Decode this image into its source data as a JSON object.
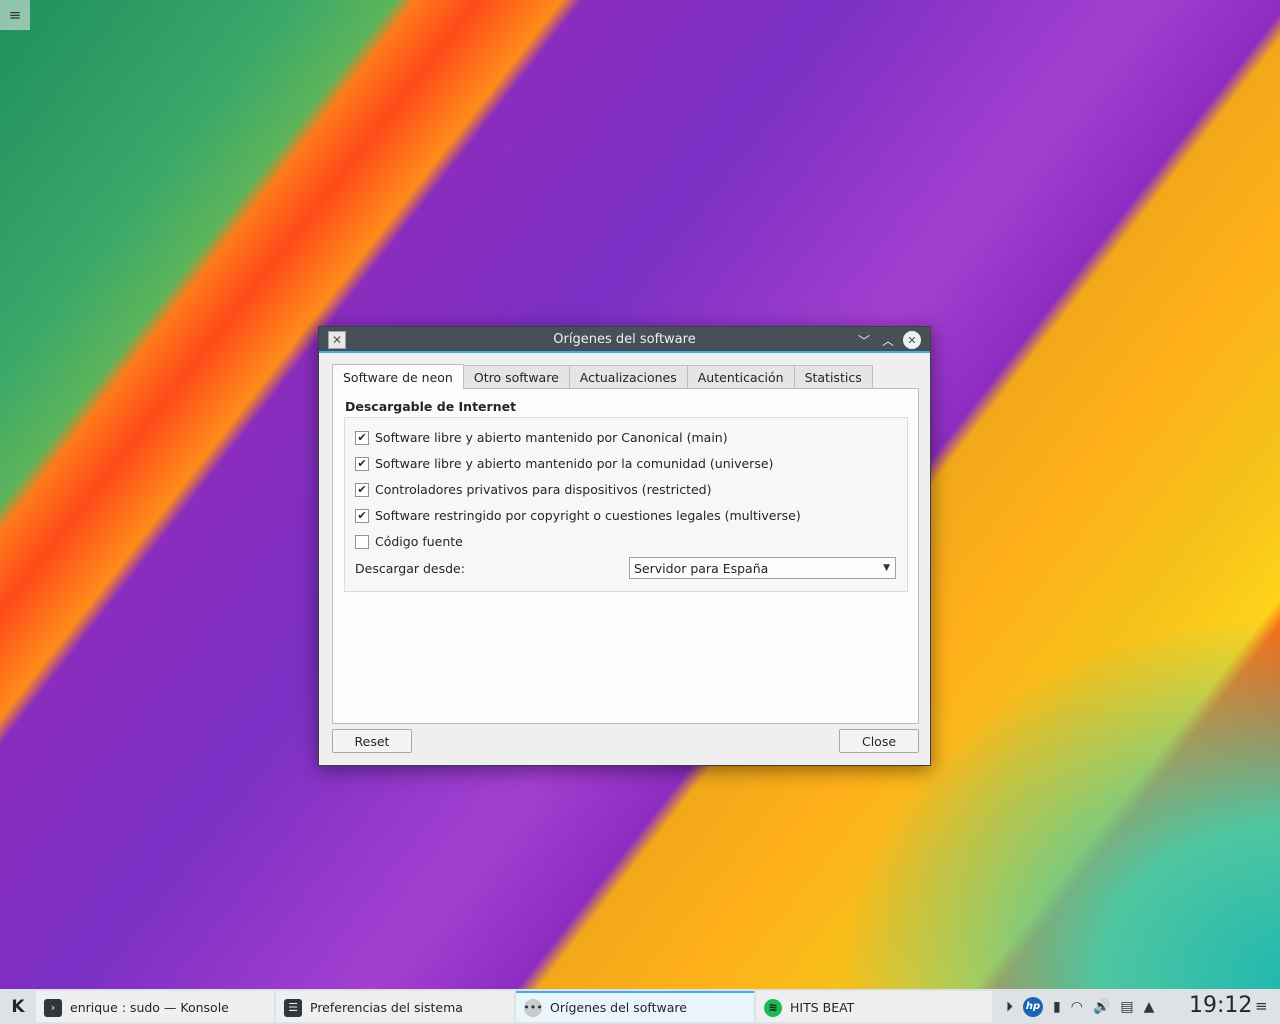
{
  "desktop": {
    "menu_icon": "hamburger-icon"
  },
  "window": {
    "title": "Orígenes del software",
    "tabs": [
      {
        "label": "Software de neon",
        "active": true
      },
      {
        "label": "Otro software",
        "active": false
      },
      {
        "label": "Actualizaciones",
        "active": false
      },
      {
        "label": "Autenticación",
        "active": false
      },
      {
        "label": "Statistics",
        "active": false
      }
    ],
    "group_title": "Descargable de Internet",
    "options": [
      {
        "label": "Software libre y abierto mantenido por Canonical (main)",
        "checked": true
      },
      {
        "label": "Software libre y abierto mantenido por la comunidad (universe)",
        "checked": true
      },
      {
        "label": "Controladores privativos para dispositivos (restricted)",
        "checked": true
      },
      {
        "label": "Software restringido por copyright o cuestiones legales (multiverse)",
        "checked": true
      },
      {
        "label": "Código fuente",
        "checked": false
      }
    ],
    "download_label": "Descargar desde:",
    "download_value": "Servidor para España",
    "reset_label": "Reset",
    "close_label": "Close"
  },
  "taskbar": {
    "tasks": [
      {
        "label": "enrique : sudo — Konsole",
        "icon": "terminal-icon"
      },
      {
        "label": "Preferencias del sistema",
        "icon": "settings-icon"
      },
      {
        "label": "Orígenes del software",
        "icon": "software-sources-icon"
      },
      {
        "label": "HITS BEAT",
        "icon": "spotify-icon"
      }
    ],
    "clock": "19:12"
  }
}
